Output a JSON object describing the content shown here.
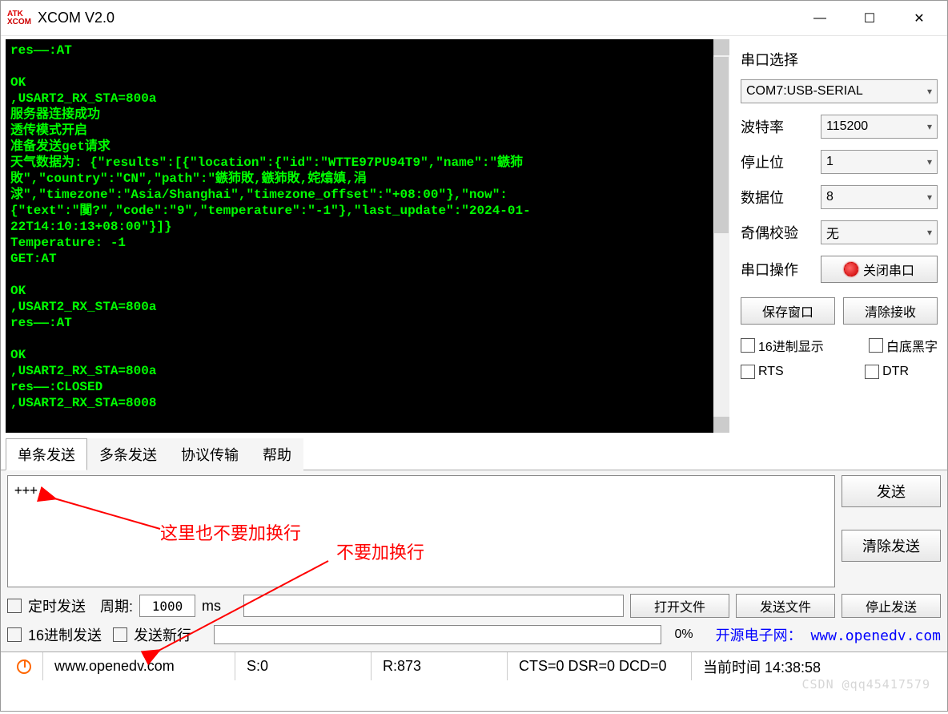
{
  "window": {
    "title": "XCOM V2.0",
    "logo_top": "ATK",
    "logo_bottom": "XCOM"
  },
  "terminal": {
    "content": "res——:AT\n\nOK\n,USART2_RX_STA=800a\n服务器连接成功\n透传模式开启\n准备发送get请求\n天气数据为: {\"results\":[{\"location\":{\"id\":\"WTTE97PU94T9\",\"name\":\"鏃犻\n敗\",\"country\":\"CN\",\"path\":\"鏃犻敗,鏃犻敗,姹熻嫃,涓\n浗\",\"timezone\":\"Asia/Shanghai\",\"timezone_offset\":\"+08:00\"},\"now\":\n{\"text\":\"闃?\",\"code\":\"9\",\"temperature\":\"-1\"},\"last_update\":\"2024-01-\n22T14:10:13+08:00\"}]}\nTemperature: -1\nGET:AT\n\nOK\n,USART2_RX_STA=800a\nres——:AT\n\nOK\n,USART2_RX_STA=800a\nres——:CLOSED\n,USART2_RX_STA=8008"
  },
  "side": {
    "title": "串口选择",
    "port": "COM7:USB-SERIAL",
    "baud_label": "波特率",
    "baud": "115200",
    "stop_label": "停止位",
    "stop": "1",
    "data_label": "数据位",
    "data": "8",
    "parity_label": "奇偶校验",
    "parity": "无",
    "op_label": "串口操作",
    "op_btn": "关闭串口",
    "save_btn": "保存窗口",
    "clear_btn": "清除接收",
    "hex_display": "16进制显示",
    "white_bg": "白底黑字",
    "rts": "RTS",
    "dtr": "DTR"
  },
  "tabs": {
    "single": "单条发送",
    "multi": "多条发送",
    "protocol": "协议传输",
    "help": "帮助"
  },
  "send": {
    "input": "+++",
    "send_btn": "发送",
    "clear_btn": "清除发送"
  },
  "opts": {
    "timed": "定时发送",
    "period_label": "周期:",
    "period": "1000",
    "ms": "ms",
    "open_file": "打开文件",
    "send_file": "发送文件",
    "stop_send": "停止发送",
    "hex_send": "16进制发送",
    "send_newline": "发送新行",
    "pct": "0%",
    "link_label": "开源电子网：",
    "link_url": "www.openedv.com"
  },
  "status": {
    "site": "www.openedv.com",
    "s": "S:0",
    "r": "R:873",
    "lines": "CTS=0 DSR=0 DCD=0",
    "time": "当前时间 14:38:58"
  },
  "annotations": {
    "text1": "这里也不要加换行",
    "text2": "不要加换行"
  },
  "watermark": "CSDN @qq45417579"
}
